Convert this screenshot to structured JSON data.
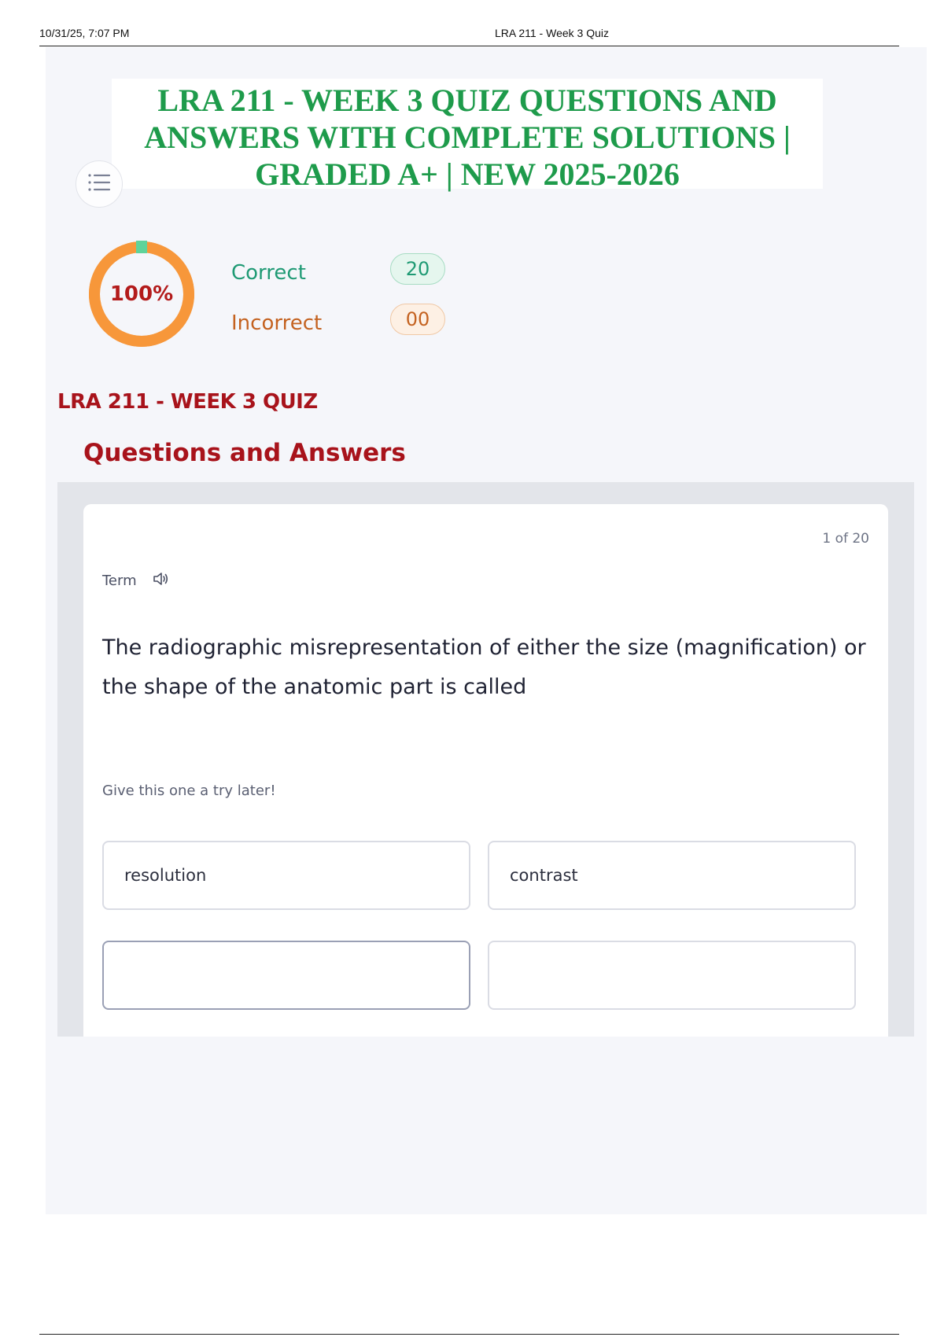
{
  "print_header": {
    "datetime": "10/31/25, 7:07 PM",
    "page_title": "LRA 211 - Week 3 Quiz"
  },
  "doc_title_lines": [
    "LRA 211 - WEEK 3 QUIZ QUESTIONS AND",
    "ANSWERS WITH COMPLETE SOLUTIONS |",
    "GRADED A+ | NEW 2025-2026"
  ],
  "menu": {
    "icon": "list-icon"
  },
  "score": {
    "percent_label": "100%",
    "percent_value": 100,
    "correct_label": "Correct",
    "correct_count": "20",
    "incorrect_label": "Incorrect",
    "incorrect_count": "00",
    "colors": {
      "ring": "#f7973a",
      "marker": "#5fd39a",
      "text": "#b31b1b"
    }
  },
  "quiz_heading": "LRA 211 - WEEK 3 QUIZ",
  "qa_heading": "Questions and Answers",
  "card": {
    "counter": "1 of 20",
    "term_label": "Term",
    "audio_icon": "speaker-icon",
    "question": "The radiographic misrepresentation of either the size (magnification) or the shape of the anatomic part is called",
    "hint": "Give this one a try later!",
    "options": [
      "resolution",
      "contrast",
      "",
      ""
    ]
  },
  "colors": {
    "title_green": "#1e9b4b",
    "heading_red": "#a8131b"
  }
}
